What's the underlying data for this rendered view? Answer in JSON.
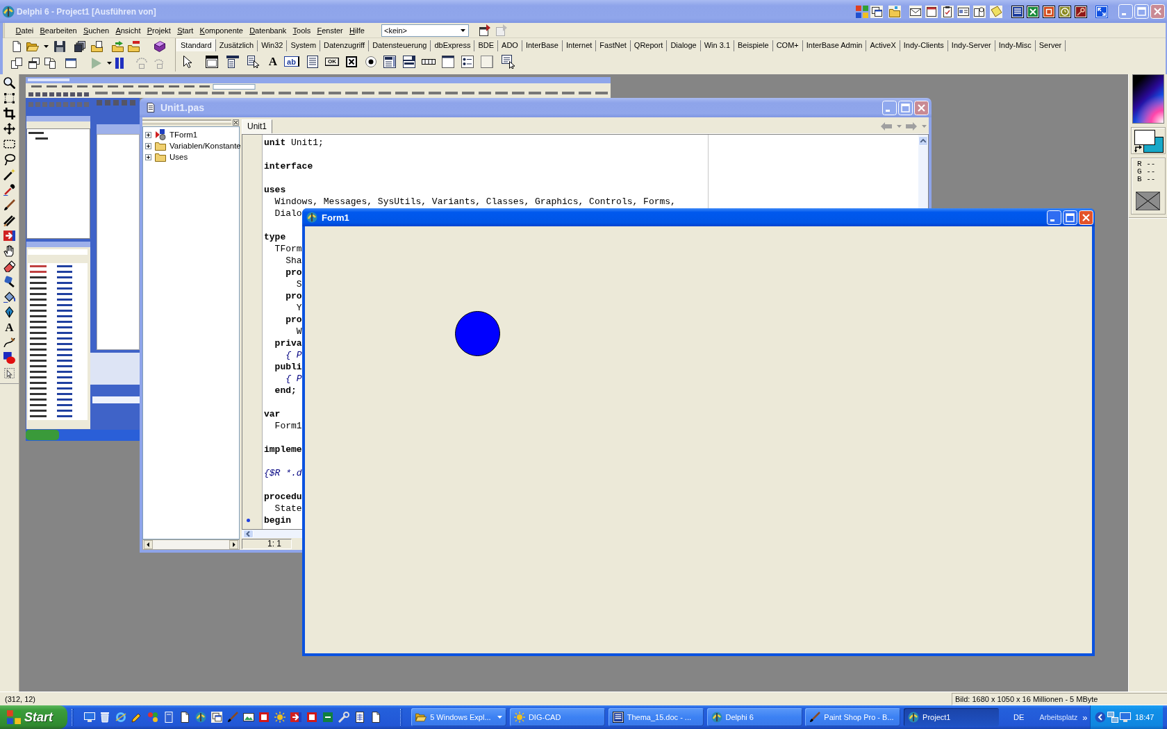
{
  "ide": {
    "title": "Delphi 6 - Project1 [Ausführen von]",
    "active": false,
    "menu": [
      "Datei",
      "Bearbeiten",
      "Suchen",
      "Ansicht",
      "Projekt",
      "Start",
      "Komponente",
      "Datenbank",
      "Tools",
      "Fenster",
      "Hilfe"
    ],
    "target_combo": {
      "value": "<kein>"
    },
    "palette_tabs": [
      {
        "label": "Standard",
        "selected": true
      },
      {
        "label": "Zusätzlich",
        "selected": false
      },
      {
        "label": "Win32",
        "selected": false
      },
      {
        "label": "System",
        "selected": false
      },
      {
        "label": "Datenzugriff",
        "selected": false
      },
      {
        "label": "Datensteuerung",
        "selected": false
      },
      {
        "label": "dbExpress",
        "selected": false
      },
      {
        "label": "BDE",
        "selected": false
      },
      {
        "label": "ADO",
        "selected": false
      },
      {
        "label": "InterBase",
        "selected": false
      },
      {
        "label": "Internet",
        "selected": false
      },
      {
        "label": "FastNet",
        "selected": false
      },
      {
        "label": "QReport",
        "selected": false
      },
      {
        "label": "Dialoge",
        "selected": false
      },
      {
        "label": "Win 3.1",
        "selected": false
      },
      {
        "label": "Beispiele",
        "selected": false
      },
      {
        "label": "COM+",
        "selected": false
      },
      {
        "label": "InterBase Admin",
        "selected": false
      },
      {
        "label": "ActiveX",
        "selected": false
      },
      {
        "label": "Indy-Clients",
        "selected": false
      },
      {
        "label": "Indy-Server",
        "selected": false
      },
      {
        "label": "Indy-Misc",
        "selected": false
      },
      {
        "label": "Server",
        "selected": false
      }
    ],
    "component_glyphs": [
      "A",
      "ab",
      "OK"
    ]
  },
  "paint_shop": {
    "text_tool_glyph": "A",
    "rgb_readout": [
      "R --",
      "G --",
      "B --"
    ]
  },
  "unit_window": {
    "title": "Unit1.pas",
    "active": false,
    "tree": [
      {
        "label": "TForm1",
        "expanded": false
      },
      {
        "label": "Variablen/Konstante",
        "expanded": false
      },
      {
        "label": "Uses",
        "expanded": false
      }
    ],
    "tabs": [
      {
        "label": "Unit1",
        "selected": true
      }
    ],
    "lines": [
      {
        "text": "**unit** Unit1;",
        "kind": "plain"
      },
      {
        "kind": "blank"
      },
      {
        "text": "interface",
        "kind": "keyword"
      },
      {
        "kind": "blank"
      },
      {
        "text": "uses",
        "kind": "keyword"
      },
      {
        "text": "  Windows, Messages, SysUtils, Variants, Classes, Graphics, Controls, Forms,",
        "kind": "plain"
      },
      {
        "text": "  Dialo",
        "kind": "plain"
      },
      {
        "kind": "blank"
      },
      {
        "text": "type",
        "kind": "keyword"
      },
      {
        "text": "  TForm",
        "kind": "plain"
      },
      {
        "text": "    Sha",
        "kind": "plain"
      },
      {
        "text": "    pro",
        "kind": "keyword"
      },
      {
        "text": "      S",
        "kind": "plain"
      },
      {
        "text": "    pro",
        "kind": "keyword"
      },
      {
        "text": "      Y",
        "kind": "plain"
      },
      {
        "text": "    pro",
        "kind": "keyword"
      },
      {
        "text": "      W",
        "kind": "plain"
      },
      {
        "text": "  priva",
        "kind": "keyword"
      },
      {
        "text": "    { P",
        "kind": "comment"
      },
      {
        "text": "  publi",
        "kind": "keyword"
      },
      {
        "text": "    { P",
        "kind": "comment"
      },
      {
        "text": "  end;",
        "kind": "keyword"
      },
      {
        "kind": "blank"
      },
      {
        "text": "var",
        "kind": "keyword"
      },
      {
        "text": "  Form1",
        "kind": "plain"
      },
      {
        "kind": "blank"
      },
      {
        "text": "impleme",
        "kind": "keyword"
      },
      {
        "kind": "blank"
      },
      {
        "text": "{$R *.d",
        "kind": "comment"
      },
      {
        "kind": "blank"
      },
      {
        "text": "procedu",
        "kind": "keyword"
      },
      {
        "text": "  State",
        "kind": "plain"
      },
      {
        "text": "begin",
        "kind": "keyword",
        "gutter_dot": true
      }
    ],
    "cursor_position": "1: 1"
  },
  "form_window": {
    "title": "Form1",
    "active": true
  },
  "status_bar": {
    "position": "(312, 12)",
    "image_info": "Bild: 1680 x 1050 x 16 Millionen - 5 MByte"
  },
  "taskbar": {
    "start": "Start",
    "tasks": [
      {
        "label": "5 Windows Expl...",
        "selected": false,
        "grouped": true
      },
      {
        "label": "DIG-CAD",
        "selected": false,
        "grouped": false
      },
      {
        "label": "Thema_15.doc - ...",
        "selected": false,
        "grouped": false
      },
      {
        "label": "Delphi 6",
        "selected": false,
        "grouped": false
      },
      {
        "label": "Paint Shop Pro - B...",
        "selected": false,
        "grouped": false
      },
      {
        "label": "Project1",
        "selected": true,
        "grouped": false
      }
    ],
    "language": "DE",
    "toolbar": "Arbeitsplatz",
    "chevron": "»",
    "clock": "18:47"
  }
}
